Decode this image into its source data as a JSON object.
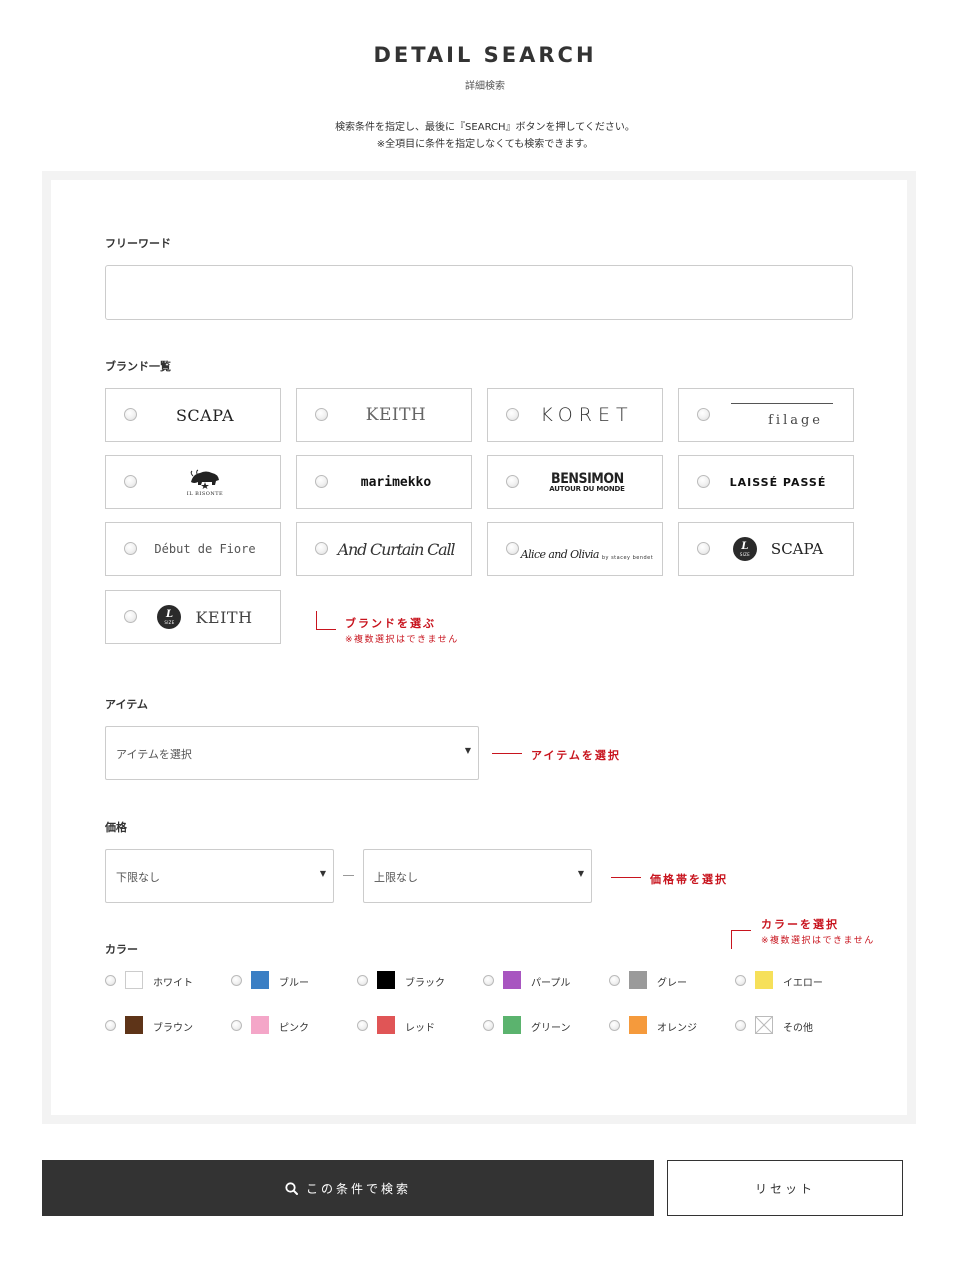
{
  "header": {
    "title": "DETAIL SEARCH",
    "subtitle": "詳細検索",
    "intro_line1": "検索条件を指定し、最後に『SEARCH』ボタンを押してください。",
    "intro_line2": "※全項目に条件を指定しなくても検索できます。"
  },
  "freeword": {
    "label": "フリーワード",
    "value": ""
  },
  "brands": {
    "label": "ブランド一覧",
    "items": [
      {
        "text": "SCAPA"
      },
      {
        "text": "KEITH"
      },
      {
        "text": "KORET"
      },
      {
        "text": "filage"
      },
      {
        "text": "IL BISONTE"
      },
      {
        "text": "marimekko"
      },
      {
        "text": "BENSIMON",
        "sub": "AUTOUR DU MONDE"
      },
      {
        "text": "LAISSÉ PASSÉ"
      },
      {
        "text": "Début de Fiore"
      },
      {
        "text": "And Curtain Call"
      },
      {
        "text": "Alice and Olivia",
        "sub": "by stacey bendet"
      },
      {
        "badge": "L",
        "badge_sub": "SIZE",
        "text": "SCAPA"
      },
      {
        "badge": "L",
        "badge_sub": "SIZE",
        "text": "KEITH"
      }
    ],
    "note": "ブランドを選ぶ",
    "note_sub": "※複数選択はできません"
  },
  "item": {
    "label": "アイテム",
    "placeholder": "アイテムを選択",
    "note": "アイテムを選択"
  },
  "price": {
    "label": "価格",
    "min_placeholder": "下限なし",
    "max_placeholder": "上限なし",
    "note": "価格帯を選択"
  },
  "color": {
    "label": "カラー",
    "note": "カラーを選択",
    "note_sub": "※複数選択はできません",
    "items": [
      {
        "name": "ホワイト",
        "color": "#ffffff"
      },
      {
        "name": "ブルー",
        "color": "#3b7fc4"
      },
      {
        "name": "ブラック",
        "color": "#000000"
      },
      {
        "name": "パープル",
        "color": "#a855c0"
      },
      {
        "name": "グレー",
        "color": "#9a9a9a"
      },
      {
        "name": "イエロー",
        "color": "#f6e05a"
      },
      {
        "name": "ブラウン",
        "color": "#5e3418"
      },
      {
        "name": "ピンク",
        "color": "#f4a6c8"
      },
      {
        "name": "レッド",
        "color": "#e05556"
      },
      {
        "name": "グリーン",
        "color": "#5bb36e"
      },
      {
        "name": "オレンジ",
        "color": "#f59a3c"
      },
      {
        "name": "その他",
        "color": "#ffffff",
        "icon": "crossed-box-icon"
      }
    ]
  },
  "actions": {
    "search_label": "この条件で検索",
    "reset_label": "リセット"
  },
  "icons": {
    "search": "search-icon"
  },
  "theme": {
    "accent": "#c8141e",
    "dark": "#333333"
  }
}
